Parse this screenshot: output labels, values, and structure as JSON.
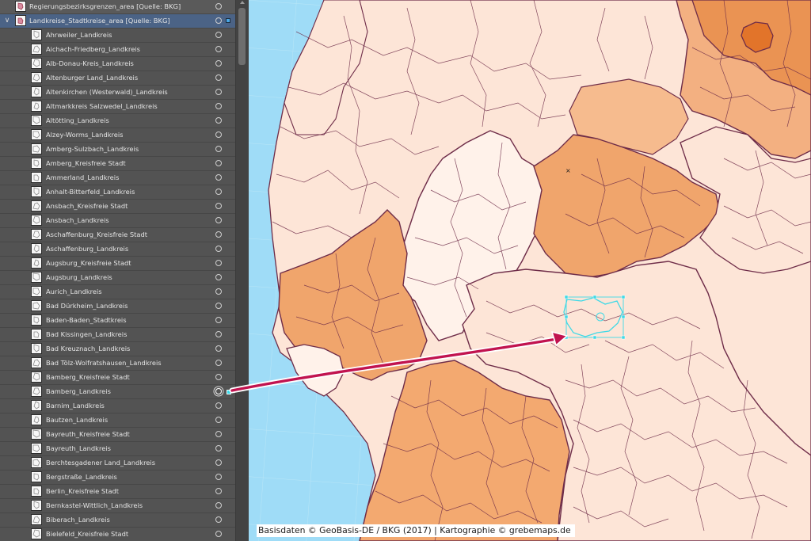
{
  "layers": {
    "groups": [
      {
        "label": "Regierungsbezirksgrenzen_area [Quelle: BKG]"
      },
      {
        "label": "Landkreise_Stadtkreise_area [Quelle: BKG]"
      }
    ],
    "items": [
      "Ahrweiler_Landkreis",
      "Aichach-Friedberg_Landkreis",
      "Alb-Donau-Kreis_Landkreis",
      "Altenburger Land_Landkreis",
      "Altenkirchen (Westerwald)_Landkreis",
      "Altmarkkreis Salzwedel_Landkreis",
      "Altötting_Landkreis",
      "Alzey-Worms_Landkreis",
      "Amberg-Sulzbach_Landkreis",
      "Amberg_Kreisfreie Stadt",
      "Ammerland_Landkreis",
      "Anhalt-Bitterfeld_Landkreis",
      "Ansbach_Kreisfreie Stadt",
      "Ansbach_Landkreis",
      "Aschaffenburg_Kreisfreie Stadt",
      "Aschaffenburg_Landkreis",
      "Augsburg_Kreisfreie Stadt",
      "Augsburg_Landkreis",
      "Aurich_Landkreis",
      "Bad Dürkheim_Landkreis",
      "Baden-Baden_Stadtkreis",
      "Bad Kissingen_Landkreis",
      "Bad Kreuznach_Landkreis",
      "Bad Tölz-Wolfratshausen_Landkreis",
      "Bamberg_Kreisfreie Stadt",
      "Bamberg_Landkreis",
      "Barnim_Landkreis",
      "Bautzen_Landkreis",
      "Bayreuth_Kreisfreie Stadt",
      "Bayreuth_Landkreis",
      "Berchtesgadener Land_Landkreis",
      "Bergstraße_Landkreis",
      "Berlin_Kreisfreie Stadt",
      "Bernkastel-Wittlich_Landkreis",
      "Biberach_Landkreis",
      "Bielefeld_Kreisfreie Stadt"
    ],
    "selected_item": "Bamberg_Landkreis"
  },
  "map": {
    "credit": "Basisdaten © GeoBasis-DE / BKG (2017)  |  Kartographie © grebemaps.de"
  },
  "colors": {
    "panel_bg": "#535353",
    "selected_row": "#4b6386",
    "water": "#9fdcf7",
    "state_light": "#fde5d7",
    "state_lightest": "#fff2ea",
    "state_mid": "#f6bb8e",
    "state_dark": "#f0a56c",
    "state_darker": "#ea9353",
    "berlin": "#e2742a",
    "border": "#6e2c48",
    "selection": "#3fd9e6",
    "arrow": "#c1134f"
  }
}
